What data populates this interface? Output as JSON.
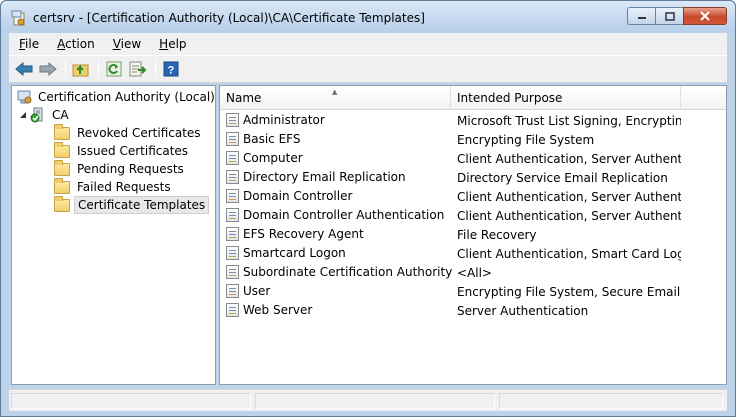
{
  "window": {
    "title": "certsrv - [Certification Authority (Local)\\CA\\Certificate Templates]"
  },
  "menu": [
    {
      "key": "F",
      "rest": "ile"
    },
    {
      "key": "A",
      "rest": "ction"
    },
    {
      "key": "V",
      "rest": "iew"
    },
    {
      "key": "H",
      "rest": "elp"
    }
  ],
  "toolbar": {
    "buttons": [
      "back-arrow-icon",
      "forward-arrow-icon",
      "up-folder-icon",
      "refresh-icon",
      "export-list-icon",
      "help-icon"
    ],
    "help_glyph": "?"
  },
  "tree": {
    "root": "Certification Authority (Local)",
    "ca": "CA",
    "children": [
      "Revoked Certificates",
      "Issued Certificates",
      "Pending Requests",
      "Failed Requests",
      "Certificate Templates"
    ],
    "selected": "Certificate Templates"
  },
  "list": {
    "columns": {
      "name": "Name",
      "purpose": "Intended Purpose"
    },
    "sort_arrow": "▲",
    "rows": [
      {
        "name": "Administrator",
        "purpose": "Microsoft Trust List Signing, Encrypting..."
      },
      {
        "name": "Basic EFS",
        "purpose": "Encrypting File System"
      },
      {
        "name": "Computer",
        "purpose": "Client Authentication, Server Authentic..."
      },
      {
        "name": "Directory Email Replication",
        "purpose": "Directory Service Email Replication"
      },
      {
        "name": "Domain Controller",
        "purpose": "Client Authentication, Server Authentic..."
      },
      {
        "name": "Domain Controller Authentication",
        "purpose": "Client Authentication, Server Authentic..."
      },
      {
        "name": "EFS Recovery Agent",
        "purpose": "File Recovery"
      },
      {
        "name": "Smartcard Logon",
        "purpose": "Client Authentication, Smart Card Logon"
      },
      {
        "name": "Subordinate Certification Authority",
        "purpose": "<All>"
      },
      {
        "name": "User",
        "purpose": "Encrypting File System, Secure Email, Cl..."
      },
      {
        "name": "Web Server",
        "purpose": "Server Authentication"
      }
    ]
  },
  "colors": {
    "accent": "#3c7fb1",
    "close_button": "#c74a2c",
    "folder": "#f1cf6a"
  }
}
